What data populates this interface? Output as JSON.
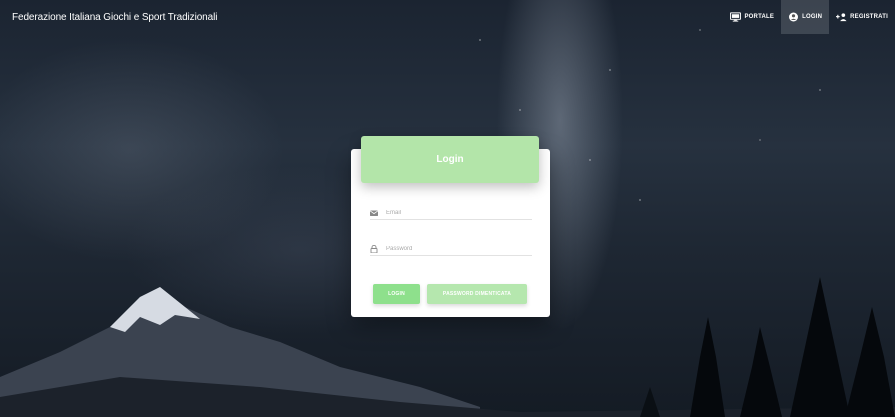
{
  "navbar": {
    "brand": "Federazione Italiana Giochi e Sport Tradizionali",
    "items": [
      {
        "label": "PORTALE",
        "icon": "monitor-icon"
      },
      {
        "label": "LOGIN",
        "icon": "user-circle-icon",
        "active": true
      },
      {
        "label": "REGISTRATI",
        "icon": "user-plus-icon"
      }
    ]
  },
  "login": {
    "title": "Login",
    "email_placeholder": "Email",
    "email_icon": "envelope-icon",
    "password_placeholder": "Password",
    "password_icon": "lock-icon",
    "login_button": "LOGIN",
    "forgot_button": "PASSWORD DIMENTICATA"
  },
  "colors": {
    "header_green": "#b3e5a9",
    "login_button_green": "#8ee08c",
    "forgot_button_green": "#b5e7ae"
  }
}
